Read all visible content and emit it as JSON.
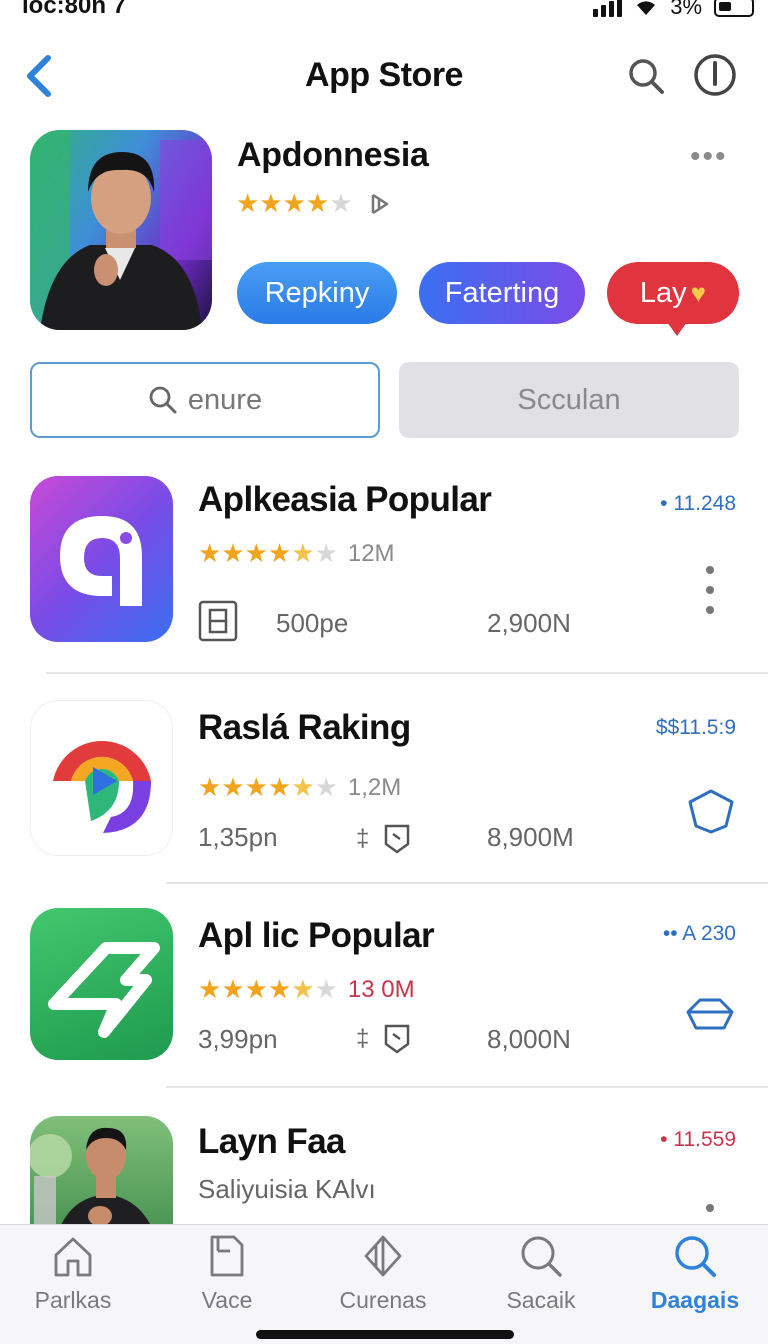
{
  "status_bar": {
    "time": "loc:80n  7",
    "battery": "3%"
  },
  "nav": {
    "title": "App Store",
    "back_icon": "chevron-left-icon",
    "search_icon": "search-icon",
    "info_icon": "info-icon"
  },
  "featured": {
    "title": "Apdonnesia",
    "rating_stars": 4.5,
    "more_label": "•••",
    "buttons": [
      "Repkiny",
      "Faterting",
      "Lay"
    ]
  },
  "search": {
    "placeholder": "enure",
    "secondary_label": "Scculan"
  },
  "apps": [
    {
      "title": "Aplkeasia Popular",
      "rating": "12M",
      "meta_1": "500pe",
      "meta_2": "2,900N",
      "badge": "• 11.248"
    },
    {
      "title": "Raslá Raking",
      "rating": "1,2M",
      "meta_1": "1,35pn",
      "meta_2": "8,900M",
      "badge": "$$11.5:9"
    },
    {
      "title": "Apl lic Popular",
      "rating": "13 0M",
      "meta_1": "3,99pn",
      "meta_2": "8,000N",
      "badge": "•• A 230"
    },
    {
      "title": "Layn Faa",
      "subtitle": "Saliyuisia KAlvı",
      "badge": "• 11.559"
    }
  ],
  "tabs": [
    "Parlkas",
    "Vace",
    "Curenas",
    "Sacaik",
    "Daagais"
  ],
  "colors": {
    "accent": "#2f82d9",
    "star": "#f2a51c",
    "red": "#e0343e"
  }
}
